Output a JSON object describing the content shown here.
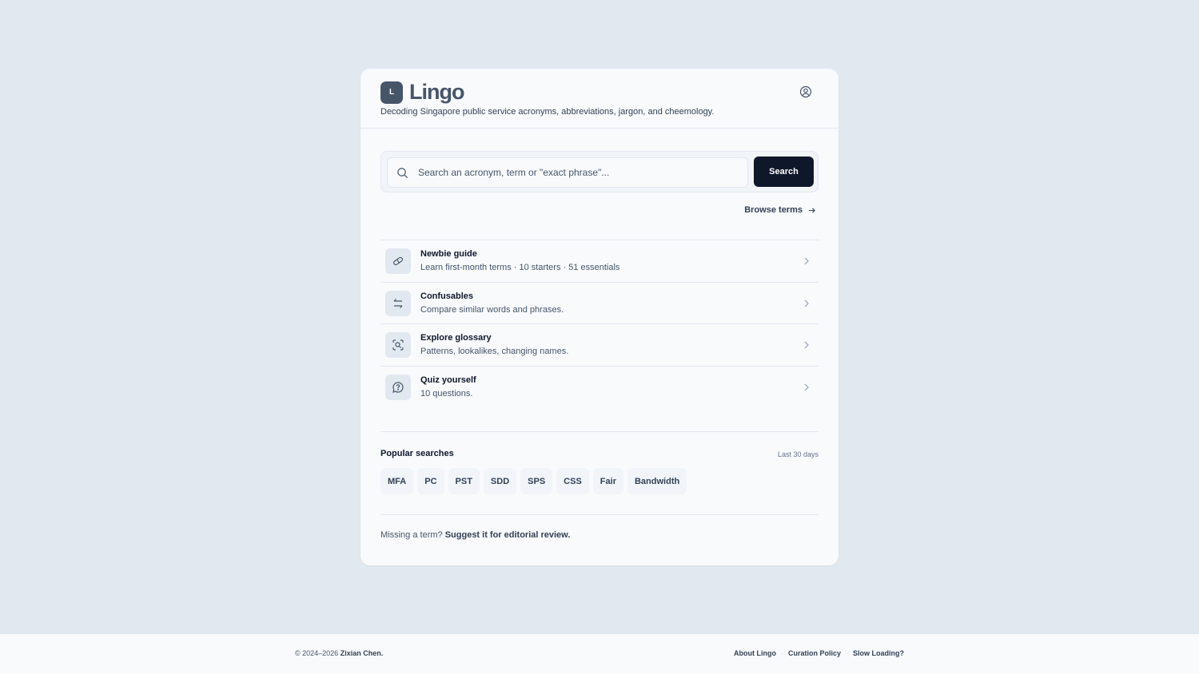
{
  "app": {
    "logo_letter": "L",
    "name": "Lingo",
    "tagline": "Decoding Singapore public service acronyms, abbreviations, jargon, and cheemology."
  },
  "search": {
    "placeholder": "Search an acronym, term or \"exact phrase\"...",
    "button_label": "Search"
  },
  "browse_label": "Browse terms",
  "nav": [
    {
      "title": "Newbie guide",
      "desc": "Learn first-month terms · 10 starters · 51 essentials",
      "icon": "pill-icon"
    },
    {
      "title": "Confusables",
      "desc": "Compare similar words and phrases.",
      "icon": "arrows-swap-icon"
    },
    {
      "title": "Explore glossary",
      "desc": "Patterns, lookalikes, changing names.",
      "icon": "scan-search-icon"
    },
    {
      "title": "Quiz yourself",
      "desc": "10 questions.",
      "icon": "help-bubble-icon"
    }
  ],
  "popular": {
    "title": "Popular searches",
    "range": "Last 30 days",
    "chips": [
      "MFA",
      "PC",
      "PST",
      "SDD",
      "SPS",
      "CSS",
      "Fair",
      "Bandwidth"
    ]
  },
  "missing": {
    "prefix": "Missing a term?",
    "link": "Suggest it for editorial review."
  },
  "footer": {
    "copyright_prefix": "© 2024–2026",
    "author": "Zixian Chen.",
    "links": [
      "About Lingo",
      "Curation Policy",
      "Slow Loading?"
    ]
  },
  "colors": {
    "background": "#e2e8f0",
    "card": "#f8fafc",
    "primary_button": "#0f172a",
    "logo_mark": "#475569"
  }
}
